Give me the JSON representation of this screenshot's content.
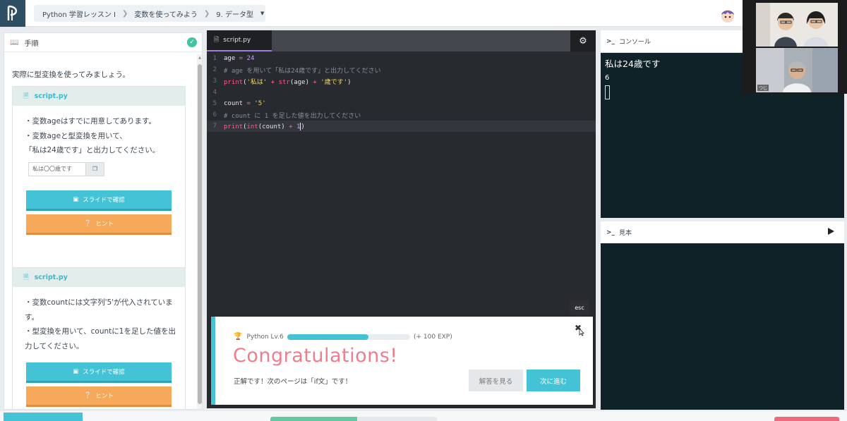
{
  "breadcrumb": {
    "course": "Python 学習レッスン I",
    "lesson": "変数を使ってみよう",
    "page": "9. データ型"
  },
  "instructions": {
    "header": "手順",
    "intro": "実際に型変換を使ってみましょう。",
    "cards": [
      {
        "file": "script.py",
        "lines": [
          "・変数ageはすでに用意してあります。",
          "・変数ageと型変換を用いて、",
          "「私は24歳です」と出力してください。"
        ],
        "copy_text": "私は〇〇歳です",
        "slide_label": "スライドで確認",
        "hint_label": "ヒント"
      },
      {
        "file": "script.py",
        "lines": [
          "・変数countには文字列'5'が代入されています。",
          "・型変換を用いて、countに1を足した値を出力してください。"
        ],
        "slide_label": "スライドで確認",
        "hint_label": "ヒント"
      }
    ]
  },
  "editor": {
    "tab": "script.py",
    "line_numbers": [
      "1",
      "2",
      "3",
      "4",
      "5",
      "6",
      "7"
    ],
    "code": {
      "l1_var": "age",
      "l1_op": " = ",
      "l1_num": "24",
      "l2": "# age を用いて「私は24歳です」と出力してください",
      "l3_print": "print",
      "l3_open": "(",
      "l3_s1": "'私は'",
      "l3_plus1": " + ",
      "l3_str": "str",
      "l3_arg": "(age)",
      "l3_plus2": " + ",
      "l3_s2": "'歳です'",
      "l3_close": ")",
      "l5_var": "count",
      "l5_op": " = ",
      "l5_str": "'5'",
      "l6": "# count に 1 を足した値を出力してください",
      "l7_print": "print",
      "l7_open": "(",
      "l7_int": "int",
      "l7_arg": "(count)",
      "l7_plus": " + ",
      "l7_num": "1",
      "l7_close": ")"
    }
  },
  "console": {
    "title": "コンソール",
    "prompt_icon": ">_",
    "output": [
      "私は24歳です",
      "6"
    ]
  },
  "sample": {
    "title": "見本",
    "prompt_icon": ">_"
  },
  "video": {
    "participant_label": "つじ"
  },
  "modal": {
    "level": "Python Lv.6",
    "progress": 0.66,
    "exp": "(+ 100 EXP)",
    "title": "Congratulations!",
    "message": "正解です！次のページは「if文」です！",
    "answer_label": "解答を見る",
    "next_label": "次に進む",
    "close_tooltip": "esc"
  },
  "bottom": {
    "progress": 0.52
  },
  "colors": {
    "accent": "#45c3d6",
    "hint": "#f6a95a",
    "congrats": "#ef7d8d",
    "console_bg": "#0f2227"
  }
}
